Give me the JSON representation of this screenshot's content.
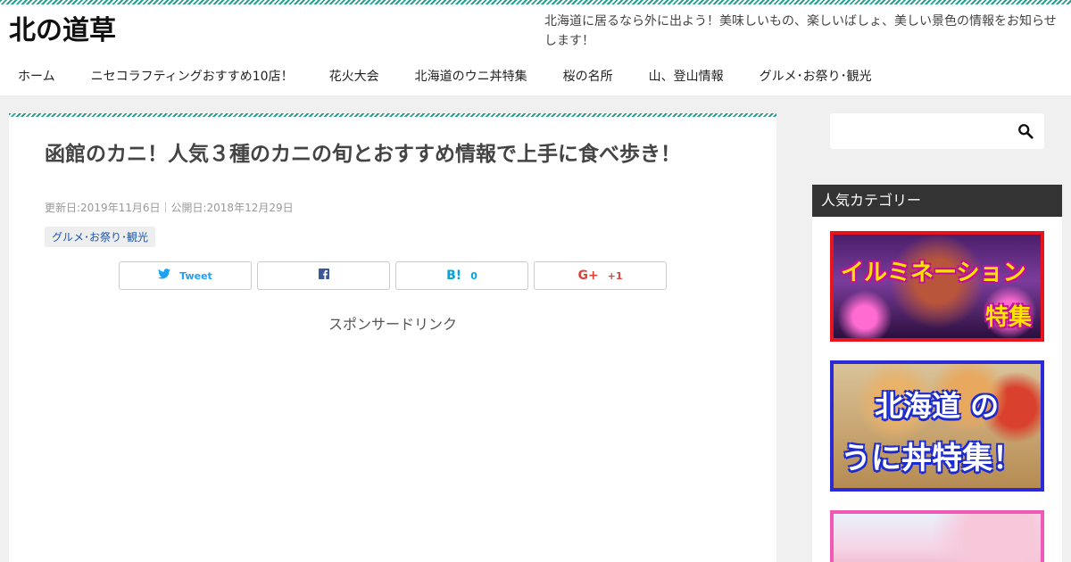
{
  "site": {
    "title": "北の道草",
    "tagline": "北海道に居るなら外に出よう！美味しいもの、楽しいばしょ、美しい景色の情報をお知らせします！"
  },
  "nav": {
    "items": [
      {
        "label": "ホーム"
      },
      {
        "label": "ニセコラフティングおすすめ10店！"
      },
      {
        "label": "花火大会"
      },
      {
        "label": "北海道のウニ丼特集"
      },
      {
        "label": "桜の名所"
      },
      {
        "label": "山、登山情報"
      },
      {
        "label": "グルメ･お祭り･観光"
      }
    ]
  },
  "article": {
    "title": "函館のカニ！人気３種のカニの旬とおすすめ情報で上手に食べ歩き！",
    "dates": "更新日:2019年11月6日｜公開日:2018年12月29日",
    "category": "グルメ･お祭り･観光",
    "sponsor": "スポンサードリンク"
  },
  "share": {
    "twitter": {
      "icon": "twitter-icon",
      "label": "Tweet",
      "color": "#1da1f2"
    },
    "facebook": {
      "icon": "facebook-icon",
      "label": "",
      "color": "#3b5998"
    },
    "hatena": {
      "icon": "hatena-bookmark-icon",
      "glyph": "B!",
      "count": "0",
      "color": "#00a4de"
    },
    "google": {
      "icon": "google-plus-icon",
      "glyph": "G+",
      "count": "+1",
      "color": "#db4437"
    }
  },
  "sidebar": {
    "search_placeholder": "",
    "popular_heading": "人気カテゴリー",
    "banners": [
      {
        "name": "illumination",
        "line1": "イルミネーション",
        "line2": "特集",
        "border_color": "#e8141d"
      },
      {
        "name": "uni",
        "line1": "北海道 の",
        "line2": "うに丼特集！",
        "border_color": "#2a2ad6"
      },
      {
        "name": "sakura",
        "border_color": "#f05ab6"
      }
    ]
  }
}
